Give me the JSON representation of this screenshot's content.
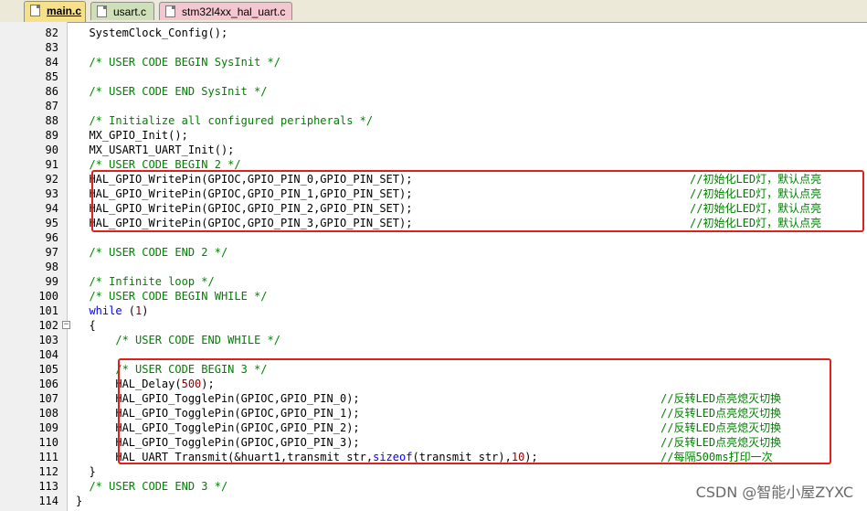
{
  "tabs": [
    {
      "label": "main.c",
      "active": true
    },
    {
      "label": "usart.c",
      "active": false
    },
    {
      "label": "stm32l4xx_hal_uart.c",
      "active": false
    }
  ],
  "lines": [
    {
      "num": "82",
      "code": "  SystemClock_Config();",
      "comment": ""
    },
    {
      "num": "83",
      "code": "",
      "comment": ""
    },
    {
      "num": "84",
      "code": "  /* USER CODE BEGIN SysInit */",
      "comment": ""
    },
    {
      "num": "85",
      "code": "",
      "comment": ""
    },
    {
      "num": "86",
      "code": "  /* USER CODE END SysInit */",
      "comment": ""
    },
    {
      "num": "87",
      "code": "",
      "comment": ""
    },
    {
      "num": "88",
      "code": "  /* Initialize all configured peripherals */",
      "comment": ""
    },
    {
      "num": "89",
      "code": "  MX_GPIO_Init();",
      "comment": ""
    },
    {
      "num": "90",
      "code": "  MX_USART1_UART_Init();",
      "comment": ""
    },
    {
      "num": "91",
      "code": "  /* USER CODE BEGIN 2 */",
      "comment": ""
    },
    {
      "num": "92",
      "code": "  HAL_GPIO_WritePin(GPIOC,GPIO_PIN_0,GPIO_PIN_SET);",
      "comment": "//初始化LED灯，默认点亮"
    },
    {
      "num": "93",
      "code": "  HAL_GPIO_WritePin(GPIOC,GPIO_PIN_1,GPIO_PIN_SET);",
      "comment": "//初始化LED灯，默认点亮"
    },
    {
      "num": "94",
      "code": "  HAL_GPIO_WritePin(GPIOC,GPIO_PIN_2,GPIO_PIN_SET);",
      "comment": "//初始化LED灯，默认点亮"
    },
    {
      "num": "95",
      "code": "  HAL_GPIO_WritePin(GPIOC,GPIO_PIN_3,GPIO_PIN_SET);",
      "comment": "//初始化LED灯，默认点亮"
    },
    {
      "num": "96",
      "code": "",
      "comment": ""
    },
    {
      "num": "97",
      "code": "  /* USER CODE END 2 */",
      "comment": ""
    },
    {
      "num": "98",
      "code": "",
      "comment": ""
    },
    {
      "num": "99",
      "code": "  /* Infinite loop */",
      "comment": ""
    },
    {
      "num": "100",
      "code": "  /* USER CODE BEGIN WHILE */",
      "comment": ""
    },
    {
      "num": "101",
      "code": "  while (1)",
      "comment": ""
    },
    {
      "num": "102",
      "code": "  {",
      "comment": "",
      "fold": true
    },
    {
      "num": "103",
      "code": "      /* USER CODE END WHILE */",
      "comment": ""
    },
    {
      "num": "104",
      "code": "",
      "comment": ""
    },
    {
      "num": "105",
      "code": "      /* USER CODE BEGIN 3 */",
      "comment": ""
    },
    {
      "num": "106",
      "code": "      HAL_Delay(500);",
      "comment": ""
    },
    {
      "num": "107",
      "code": "      HAL_GPIO_TogglePin(GPIOC,GPIO_PIN_0);",
      "comment": "//反转LED点亮熄灭切换"
    },
    {
      "num": "108",
      "code": "      HAL_GPIO_TogglePin(GPIOC,GPIO_PIN_1);",
      "comment": "//反转LED点亮熄灭切换"
    },
    {
      "num": "109",
      "code": "      HAL_GPIO_TogglePin(GPIOC,GPIO_PIN_2);",
      "comment": "//反转LED点亮熄灭切换"
    },
    {
      "num": "110",
      "code": "      HAL_GPIO_TogglePin(GPIOC,GPIO_PIN_3);",
      "comment": "//反转LED点亮熄灭切换"
    },
    {
      "num": "111",
      "code": "      HAL_UART_Transmit(&huart1,transmit_str,sizeof(transmit_str),10);",
      "comment": "//每隔500ms打印一次"
    },
    {
      "num": "112",
      "code": "  }",
      "comment": ""
    },
    {
      "num": "113",
      "code": "  /* USER CODE END 3 */",
      "comment": ""
    },
    {
      "num": "114",
      "code": "}",
      "comment": ""
    }
  ],
  "watermark": "CSDN @智能小屋ZYXC",
  "colors": {
    "comment": "#008000",
    "keyword": "#0000ff",
    "number": "#8b0000",
    "highlight_box": "#e0201a"
  }
}
